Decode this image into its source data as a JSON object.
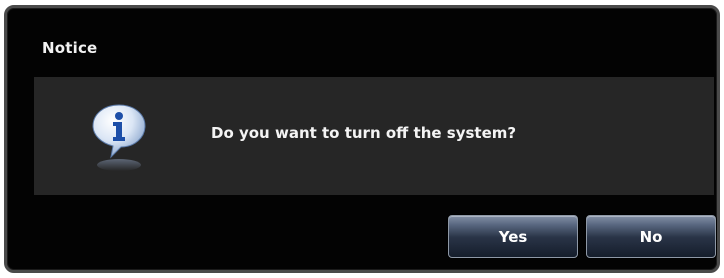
{
  "dialog": {
    "title": "Notice",
    "message": "Do you want to turn off the system?",
    "icon": "info-icon",
    "buttons": {
      "yes_label": "Yes",
      "no_label": "No"
    }
  },
  "colors": {
    "dialog_background": "#030303",
    "panel_background": "#262626",
    "border": "#4a4a4a",
    "text": "#f2f2f2",
    "button_gradient_top": "#8390a6",
    "button_gradient_bottom": "#151d2b",
    "icon_blue": "#1d4fa8"
  }
}
